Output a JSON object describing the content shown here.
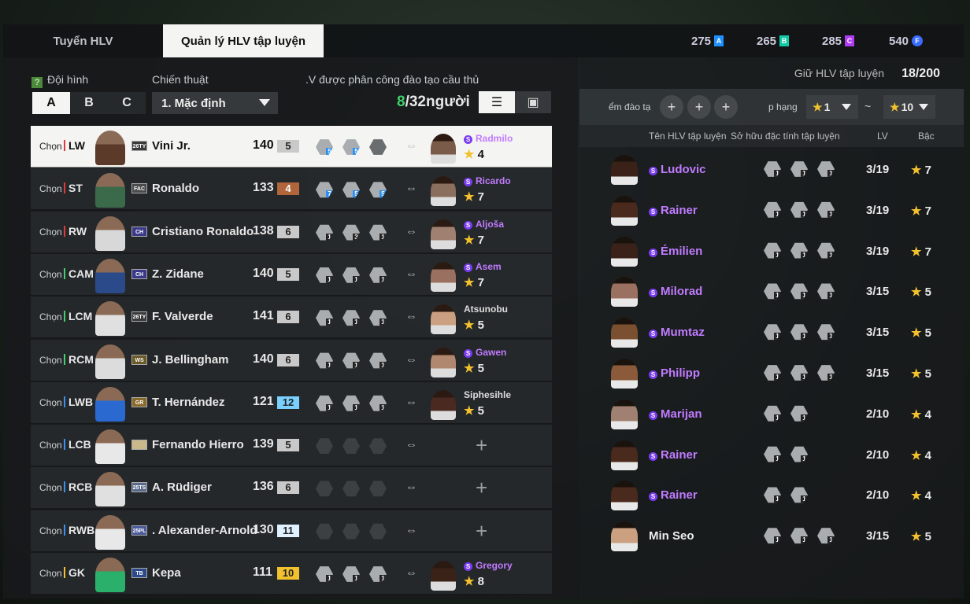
{
  "tabs": {
    "recruit": "Tuyển HLV",
    "manage": "Quản lý HLV tập luyện"
  },
  "currencies": [
    {
      "value": "275",
      "code": "A",
      "color": "#1e90ff"
    },
    {
      "value": "265",
      "code": "B",
      "color": "#12c9a5"
    },
    {
      "value": "285",
      "code": "C",
      "color": "#b13cf5"
    },
    {
      "value": "540",
      "code": "F",
      "color": "#3a6cff"
    }
  ],
  "left": {
    "lineup_label": "Đội hình",
    "help_icon": "?",
    "tactic_label": "Chiến thuật",
    "assigned_label": ".V được phân công đào tạo cầu thủ",
    "formations": [
      "A",
      "B",
      "C"
    ],
    "tactic_value": "1. Mặc định",
    "count_current": "8",
    "count_total": "/32người",
    "list_view_icon": "☰",
    "field_view_icon": "▣"
  },
  "rows": [
    {
      "choose": "Chọn",
      "pos": "LW",
      "pos_color": "#e03a3a",
      "season": "26TY",
      "season_color": "#3a3a3a",
      "name": "Vini Jr.",
      "ovr": "140",
      "grade": "5",
      "grade_bg": "#c9c9c9",
      "grade_fg": "#222",
      "badges": [
        {
          "n": "5",
          "c": "#2a8ff0"
        },
        {
          "n": "5",
          "c": "#2a8ff0"
        },
        {
          "n": "",
          "c": ""
        }
      ],
      "coach": "Radmilo",
      "special": true,
      "stars": "4",
      "player_color": "#5b3a2a",
      "coach_color": "#7a5a48"
    },
    {
      "choose": "Chọn",
      "pos": "ST",
      "pos_color": "#e03a3a",
      "season": "FAC",
      "season_color": "#4a4a4a",
      "name": "Ronaldo",
      "ovr": "133",
      "grade": "4",
      "grade_bg": "#b0653a",
      "grade_fg": "#fff",
      "badges": [
        {
          "n": "7",
          "c": "#2a8ff0"
        },
        {
          "n": "5",
          "c": "#2a8ff0"
        },
        {
          "n": "5",
          "c": "#2a8ff0"
        }
      ],
      "coach": "Ricardo",
      "special": true,
      "stars": "7",
      "player_color": "#3a6a4a",
      "coach_color": "#8a6e5e"
    },
    {
      "choose": "Chọn",
      "pos": "RW",
      "pos_color": "#e03a3a",
      "season": "CH",
      "season_color": "#3b3a8a",
      "name": "Cristiano Ronaldo",
      "ovr": "138",
      "grade": "6",
      "grade_bg": "#c9c9c9",
      "grade_fg": "#222",
      "badges": [
        {
          "n": "1",
          "c": ""
        },
        {
          "n": "3",
          "c": ""
        },
        {
          "n": "1",
          "c": ""
        }
      ],
      "coach": "Aljoša",
      "special": true,
      "stars": "7",
      "player_color": "#d8d8d8",
      "coach_color": "#a08070"
    },
    {
      "choose": "Chọn",
      "pos": "CAM",
      "pos_color": "#3fd16a",
      "season": "CH",
      "season_color": "#3b3a8a",
      "name": "Z. Zidane",
      "ovr": "140",
      "grade": "5",
      "grade_bg": "#c9c9c9",
      "grade_fg": "#222",
      "badges": [
        {
          "n": "1",
          "c": ""
        },
        {
          "n": "1",
          "c": ""
        },
        {
          "n": "1",
          "c": ""
        }
      ],
      "coach": "Asem",
      "special": true,
      "stars": "7",
      "player_color": "#2a4a8a",
      "coach_color": "#9a7060"
    },
    {
      "choose": "Chọn",
      "pos": "LCM",
      "pos_color": "#3fd16a",
      "season": "26TY",
      "season_color": "#3a3a3a",
      "name": "F. Valverde",
      "ovr": "141",
      "grade": "6",
      "grade_bg": "#c9c9c9",
      "grade_fg": "#222",
      "badges": [
        {
          "n": "1",
          "c": ""
        },
        {
          "n": "1",
          "c": ""
        },
        {
          "n": "1",
          "c": ""
        }
      ],
      "coach": "Atsunobu",
      "special": false,
      "stars": "5",
      "player_color": "#e0e0e0",
      "coach_color": "#caa080"
    },
    {
      "choose": "Chọn",
      "pos": "RCM",
      "pos_color": "#3fd16a",
      "season": "WS",
      "season_color": "#6a5a2a",
      "name": "J. Bellingham",
      "ovr": "140",
      "grade": "6",
      "grade_bg": "#c9c9c9",
      "grade_fg": "#222",
      "badges": [
        {
          "n": "1",
          "c": ""
        },
        {
          "n": "1",
          "c": ""
        },
        {
          "n": "1",
          "c": ""
        }
      ],
      "coach": "Gawen",
      "special": true,
      "stars": "5",
      "player_color": "#dcdcdc",
      "coach_color": "#b08870"
    },
    {
      "choose": "Chọn",
      "pos": "LWB",
      "pos_color": "#3a8ff0",
      "season": "GR",
      "season_color": "#8a6a2a",
      "name": "T. Hernández",
      "ovr": "121",
      "grade": "12",
      "grade_bg": "#7ad0ff",
      "grade_fg": "#222",
      "badges": [
        {
          "n": "1",
          "c": ""
        },
        {
          "n": "1",
          "c": ""
        },
        {
          "n": "1",
          "c": ""
        }
      ],
      "coach": "Siphesihle",
      "special": false,
      "stars": "5",
      "player_color": "#2a6ad0",
      "coach_color": "#4a2a20"
    },
    {
      "choose": "Chọn",
      "pos": "LCB",
      "pos_color": "#3a8ff0",
      "season": "",
      "season_color": "#c8b88a",
      "name": "Fernando Hierro",
      "ovr": "139",
      "grade": "5",
      "grade_bg": "#c9c9c9",
      "grade_fg": "#222",
      "badges": [],
      "coach": "",
      "special": false,
      "stars": "",
      "player_color": "#e8e8e8",
      "coach_color": ""
    },
    {
      "choose": "Chọn",
      "pos": "RCB",
      "pos_color": "#3a8ff0",
      "season": "25TS",
      "season_color": "#5a6a8a",
      "name": "A. Rüdiger",
      "ovr": "136",
      "grade": "6",
      "grade_bg": "#c9c9c9",
      "grade_fg": "#222",
      "badges": [],
      "coach": "",
      "special": false,
      "stars": "",
      "player_color": "#e0e0e0",
      "coach_color": ""
    },
    {
      "choose": "Chọn",
      "pos": "RWB",
      "pos_color": "#3a8ff0",
      "season": "25PL",
      "season_color": "#4a5a9a",
      "name": ". Alexander-Arnold",
      "ovr": "130",
      "grade": "11",
      "grade_bg": "#dff0ff",
      "grade_fg": "#222",
      "badges": [],
      "coach": "",
      "special": false,
      "stars": "",
      "player_color": "#e8e8e8",
      "coach_color": ""
    },
    {
      "choose": "Chọn",
      "pos": "GK",
      "pos_color": "#f2c12e",
      "season": "TB",
      "season_color": "#2a4a8a",
      "name": "Kepa",
      "ovr": "111",
      "grade": "10",
      "grade_bg": "#f2c12e",
      "grade_fg": "#222",
      "badges": [
        {
          "n": "1",
          "c": ""
        },
        {
          "n": "1",
          "c": ""
        },
        {
          "n": "1",
          "c": ""
        }
      ],
      "coach": "Gregory",
      "special": true,
      "stars": "8",
      "player_color": "#2ab06a",
      "coach_color": "#3a2218"
    }
  ],
  "right": {
    "keep_label": "Giữ HLV tập luyện",
    "keep_value": "18/200",
    "filter_label": "ểm đào tạ",
    "rank_label": "p hạng",
    "plus_icon": "+",
    "rank_min": "1",
    "rank_sep": "~",
    "rank_max": "10",
    "headers": {
      "name": "Tên HLV tập luyện",
      "traits": "Sở hữu đặc tính tập luyện",
      "lv": "LV",
      "rank": "Bậc"
    },
    "coaches": [
      {
        "name": "Ludovic",
        "special": true,
        "lv": "3/19",
        "stars": "7",
        "traits": 3,
        "color": "#3a2218"
      },
      {
        "name": "Rainer",
        "special": true,
        "lv": "3/19",
        "stars": "7",
        "traits": 3,
        "color": "#4a2a1c"
      },
      {
        "name": "Émilien",
        "special": true,
        "lv": "3/19",
        "stars": "7",
        "traits": 3,
        "color": "#3a2218"
      },
      {
        "name": "Milorad",
        "special": true,
        "lv": "3/15",
        "stars": "5",
        "traits": 3,
        "color": "#9a7060"
      },
      {
        "name": "Mumtaz",
        "special": true,
        "lv": "3/15",
        "stars": "5",
        "traits": 3,
        "color": "#7a5030"
      },
      {
        "name": "Philipp",
        "special": true,
        "lv": "3/15",
        "stars": "5",
        "traits": 3,
        "color": "#8a5a3a"
      },
      {
        "name": "Marijan",
        "special": true,
        "lv": "2/10",
        "stars": "4",
        "traits": 2,
        "color": "#a08070"
      },
      {
        "name": "Rainer",
        "special": true,
        "lv": "2/10",
        "stars": "4",
        "traits": 2,
        "color": "#4a2a1c"
      },
      {
        "name": "Rainer",
        "special": true,
        "lv": "2/10",
        "stars": "4",
        "traits": 2,
        "color": "#4a2a1c"
      },
      {
        "name": "Min Seo",
        "special": false,
        "lv": "3/15",
        "stars": "5",
        "traits": 3,
        "color": "#caa080"
      }
    ]
  }
}
